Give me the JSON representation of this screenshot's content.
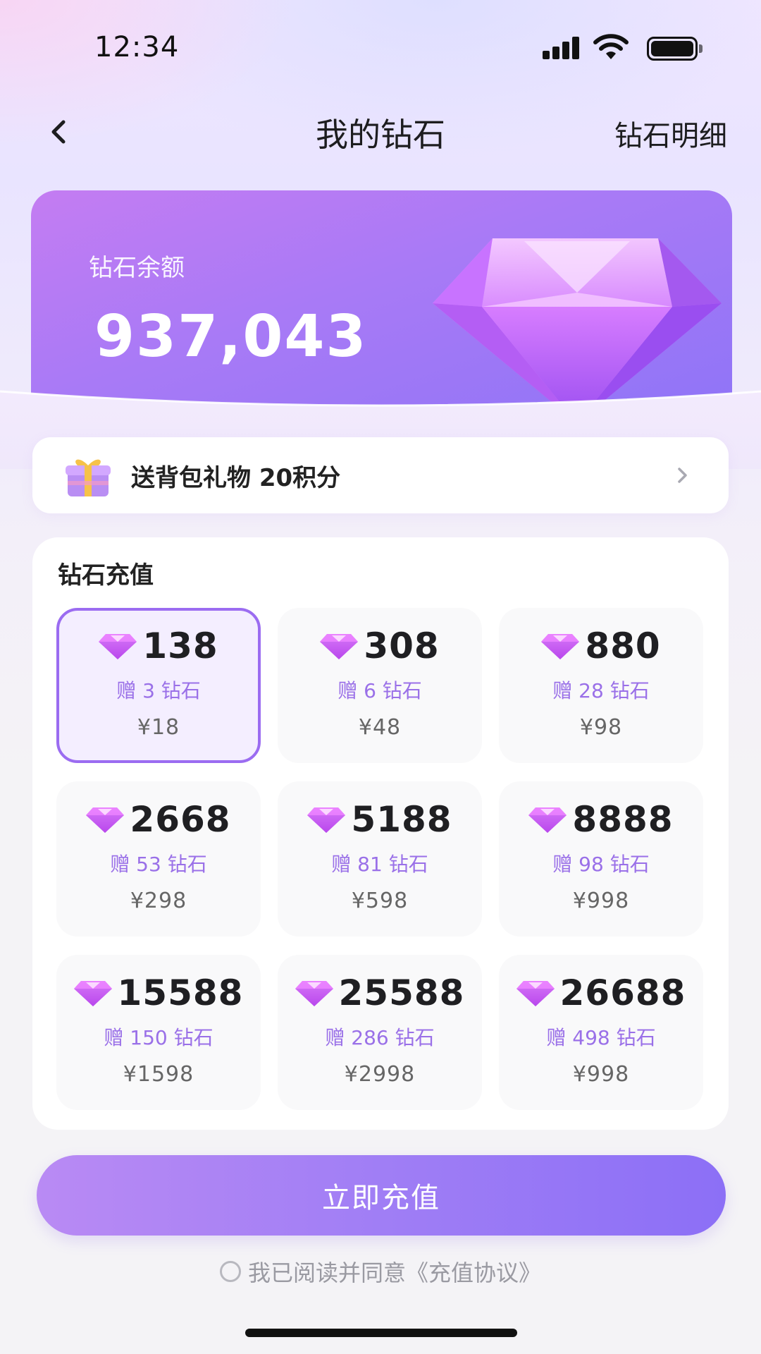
{
  "status_bar": {
    "time": "12:34",
    "signal_icon": "signal-icon",
    "wifi_icon": "wifi-icon",
    "battery_icon": "battery-icon"
  },
  "header": {
    "back_icon": "chevron-left-icon",
    "title": "我的钻石",
    "detail_link": "钻石明细"
  },
  "balance": {
    "label": "钻石余额",
    "value": "937,043",
    "icon": "diamond-icon"
  },
  "gift_banner": {
    "icon": "gift-box-icon",
    "text": "送背包礼物 20积分",
    "arrow_icon": "chevron-right-icon"
  },
  "recharge": {
    "title": "钻石充值",
    "selected_index": 0,
    "options": [
      {
        "amount": "138",
        "bonus": "赠 3 钻石",
        "price": "¥18"
      },
      {
        "amount": "308",
        "bonus": "赠 6 钻石",
        "price": "¥48"
      },
      {
        "amount": "880",
        "bonus": "赠 28 钻石",
        "price": "¥98"
      },
      {
        "amount": "2668",
        "bonus": "赠 53 钻石",
        "price": "¥298"
      },
      {
        "amount": "5188",
        "bonus": "赠 81 钻石",
        "price": "¥598"
      },
      {
        "amount": "8888",
        "bonus": "赠 98 钻石",
        "price": "¥998"
      },
      {
        "amount": "15588",
        "bonus": "赠 150 钻石",
        "price": "¥1598"
      },
      {
        "amount": "25588",
        "bonus": "赠 286 钻石",
        "price": "¥2998"
      },
      {
        "amount": "26688",
        "bonus": "赠 498 钻石",
        "price": "¥998"
      }
    ]
  },
  "cta": {
    "label": "立即充值"
  },
  "agreement": {
    "text": "我已阅读并同意",
    "link": "《充值协议》"
  },
  "colors": {
    "accent": "#9b6cf1",
    "bonus_text": "#9a70e8",
    "card_gradient_start": "#c47cf2",
    "card_gradient_end": "#8f74f7"
  }
}
